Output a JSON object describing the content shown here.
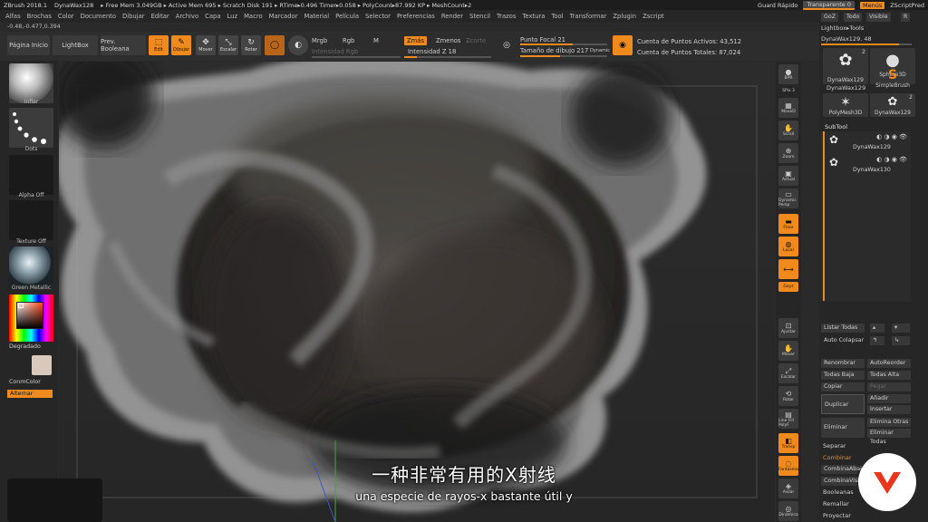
{
  "titlebar": {
    "items": [
      "ZBrush 2018.1",
      "DynaWax128",
      "▸ Free Mem 3.049GB ▸ Active Mem 695 ▸ Scratch Disk 191 ▸ RTime▸0.496 Timer▸0.058 ▸ PolyCount▸87.992 KP ▸ MeshCount▸2"
    ],
    "guard": "Guard Rápido",
    "transparent": "Transparente 0",
    "menus": "Menús",
    "script": "ZScriptPred"
  },
  "menubar": [
    "Alfas",
    "Brochas",
    "Color",
    "Documento",
    "Dibujar",
    "Editar",
    "Archivo",
    "Capa",
    "Luz",
    "Macro",
    "Marcador",
    "Material",
    "Película",
    "Selector",
    "Preferencias",
    "Render",
    "Stencil",
    "Trazos",
    "Textura",
    "Tool",
    "Transformar",
    "Zplugin",
    "Zscript"
  ],
  "coords": "-0.48,-0.477,0.394",
  "toolbar": {
    "home": "Página Inicio",
    "lightbox": "LightBox",
    "prev_bool": "Prev. Booleana",
    "edit": "Edit",
    "draw": "Dibujar",
    "move": "Mover",
    "scale": "Escalar",
    "rotate": "Rotar",
    "mrgb": "Mrgb",
    "rgb": "Rgb",
    "m": "M",
    "rgb_intensity": "Intensidad Rgb",
    "zadd": "Zmás",
    "zsub": "Zmenos",
    "zcut": "Zcorte",
    "z_intensity": "Intensidad Z 18",
    "focal": "Punto Focal 21",
    "draw_size": "Tamaño de dibujo 217",
    "dynamic": "Dynamic",
    "active_points": "Cuenta de Puntos Activos: 43,512",
    "total_points": "Cuenta de Puntos Totales: 87,024"
  },
  "left": {
    "brush": "Inflar",
    "stroke": "Dots",
    "alpha": "Alpha Off",
    "texture": "Texture Off",
    "material": "Green Metallic",
    "gradient": "Degradado",
    "switch_color": "ConmColor",
    "alternate": "Alternar"
  },
  "rightstrip": [
    "BPR",
    "SPix 3",
    "MoveD",
    "Scroll",
    "Zoom",
    "Actual",
    "Dynamic Persp",
    "Floor",
    "Local",
    "Gxyz",
    "Ajustar",
    "Mover",
    "Escalar",
    "Rotar",
    "Line Fill PolyF",
    "Transp",
    "Fantasma",
    "Solo",
    "Rasgos",
    "Aislar",
    "Dinámica"
  ],
  "rightpanel": {
    "tabs": [
      "GoZ",
      "Todo",
      "Visible",
      "R"
    ],
    "lightbox_tools": "Lightbox▸Tools",
    "current_tool": "DynaWax129. 48",
    "tools": [
      {
        "name": "DynaWax129",
        "count": "2",
        "icon": "blob-icon"
      },
      {
        "name": "Sphere3D",
        "count": "",
        "icon": "sphere-icon"
      },
      {
        "name": "DynaWax129",
        "count": "",
        "icon": "blob-icon"
      },
      {
        "name": "SimpleBrush",
        "count": "",
        "icon": "s-brush-icon"
      },
      {
        "name": "PolyMesh3D",
        "count": "",
        "icon": "star-icon"
      },
      {
        "name": "DynaWax129",
        "count": "2",
        "icon": "blob-icon"
      }
    ],
    "subtool_header": "SubTool",
    "subtools": [
      "DynaWax129",
      "DynaWax130"
    ],
    "list_all": "Listar Todas",
    "auto_collapse": "Auto Colapsar",
    "rename": "Renombrar",
    "auto_reorder": "AutoReorder",
    "all_low": "Todas Baja",
    "all_high": "Todas Alta",
    "copy": "Copiar",
    "paste": "Pegar",
    "duplicate": "Duplicar",
    "append": "Añadir",
    "insert": "Insertar",
    "delete": "Eliminar",
    "delete_other": "Elimina Otras",
    "delete_all": "Eliminar Todas",
    "split": "Separar",
    "merge": "Combinar",
    "merge_down": "CombinaAbajo",
    "merge_visible": "CombinaVisible",
    "boolean": "Booleanas",
    "remesh": "Remallar",
    "project": "Proyectar"
  },
  "subtitles": {
    "zh": "一种非常有用的X射线",
    "es": "una especie de rayos-x bastante útil y"
  },
  "colors": {
    "accent": "#f08a1c",
    "panel": "#262626",
    "button": "#3a3a3a"
  }
}
